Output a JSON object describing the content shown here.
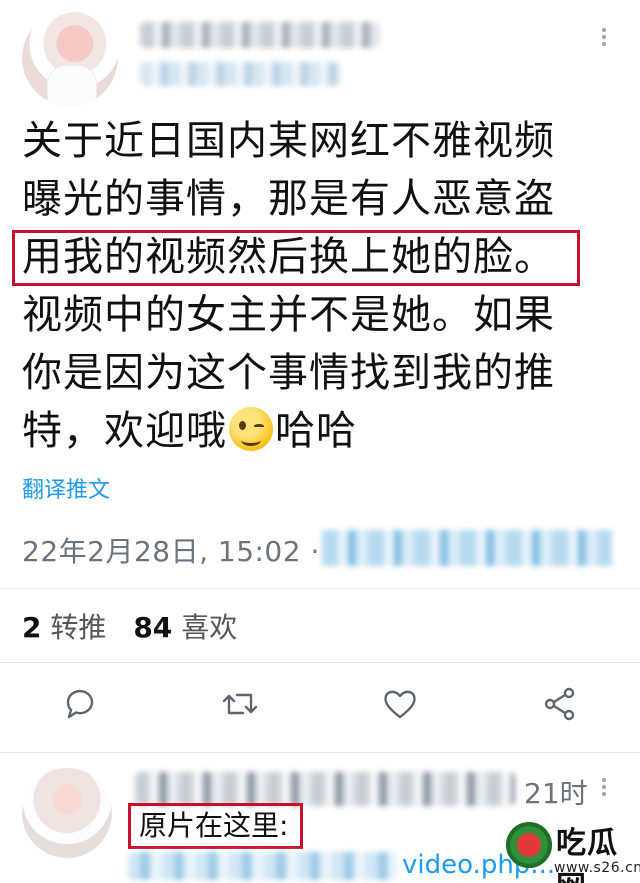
{
  "tweet": {
    "lines": [
      "关于近日国内某网红不雅视频",
      "曝光的事情，那是有人恶意盗",
      "用我的视频然后换上她的脸。",
      "视频中的女主并不是她。如果",
      "你是因为这个事情找到我的推",
      "特，欢迎哦"
    ],
    "line6_tail": "哈哈",
    "emoji": "winking-face",
    "translate_label": "翻译推文",
    "timestamp": "22年2月28日, 15:02 ·"
  },
  "stats": {
    "retweets_count": "2",
    "retweets_label": "转推",
    "likes_count": "84",
    "likes_label": "喜欢"
  },
  "actions": [
    "reply",
    "retweet",
    "like",
    "share"
  ],
  "reply": {
    "time": "21时",
    "text": "原片在这里:",
    "link_fragment": "video.php..."
  },
  "watermark": {
    "title": "吃瓜网",
    "url": "www.s26.cn"
  },
  "colors": {
    "link": "#1d9bf0",
    "highlight_box": "#c8102e",
    "muted_text": "#6b747d"
  }
}
